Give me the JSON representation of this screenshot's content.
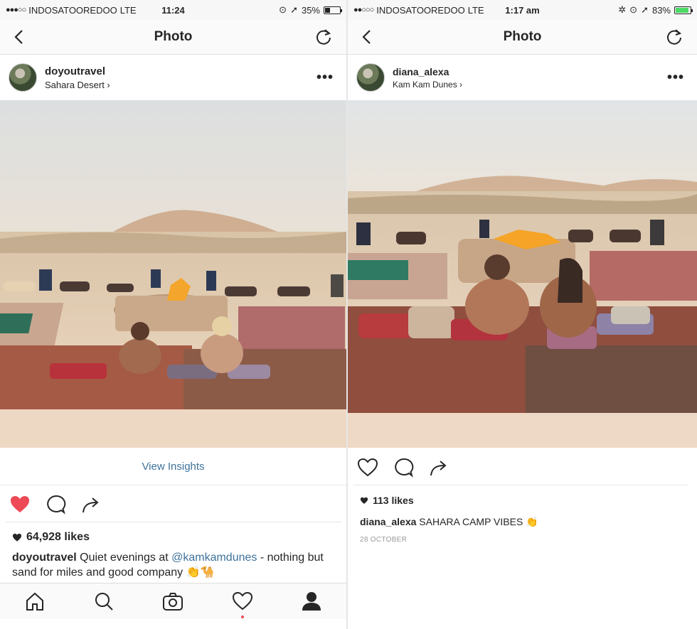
{
  "left": {
    "status": {
      "carrier": "INDOSATOOREDOO",
      "network": "LTE",
      "time": "11:24",
      "battery": "35%"
    },
    "nav": {
      "title": "Photo"
    },
    "post": {
      "username": "doyoutravel",
      "location": "Sahara Desert ›"
    },
    "insights": "View Insights",
    "likes": "64,928 likes",
    "caption": {
      "username": "doyoutravel",
      "text1": " Quiet evenings at ",
      "mention": "@kamkamdunes",
      "text2": " - nothing but sand for miles and good company 👏🐪"
    },
    "icons": {
      "like": "heart-filled-icon",
      "comment": "comment-icon",
      "share": "share-icon"
    },
    "tabs": [
      "home-icon",
      "search-icon",
      "camera-icon",
      "heart-icon",
      "profile-icon"
    ]
  },
  "right": {
    "status": {
      "carrier": "INDOSATOOREDOO",
      "network": "LTE",
      "time": "1:17 am",
      "battery": "83%"
    },
    "nav": {
      "title": "Photo"
    },
    "post": {
      "username": "diana_alexa",
      "location": "Kam Kam Dunes ›"
    },
    "likes": "113 likes",
    "caption": {
      "username": "diana_alexa",
      "text": " SAHARA CAMP VIBES 👏"
    },
    "date": "28 OCTOBER",
    "icons": {
      "like": "heart-outline-icon",
      "comment": "comment-icon",
      "share": "share-icon"
    }
  },
  "colors": {
    "like_red": "#ed4956",
    "link_blue": "#3f729b",
    "battery_green": "#4cd964"
  }
}
